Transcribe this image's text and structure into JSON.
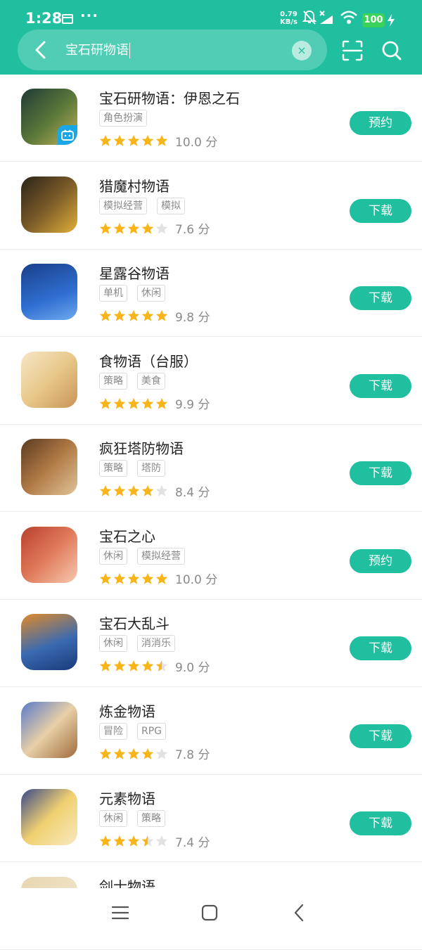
{
  "status_bar": {
    "time": "1:28",
    "more_dots": "···",
    "net_speed_value": "0.79",
    "net_speed_unit": "KB/s",
    "battery": "100"
  },
  "search": {
    "query": "宝石研物语",
    "clear_symbol": "×"
  },
  "colors": {
    "accent": "#1fbf9f",
    "star": "#f8b51a",
    "star_empty": "#e2e2e2"
  },
  "icons": [
    "back-icon",
    "clear-icon",
    "scan-icon",
    "search-icon",
    "menu-icon",
    "home-icon",
    "nav-back-icon"
  ],
  "results": [
    {
      "name": "宝石研物语：伊恩之石",
      "tags": [
        "角色扮演"
      ],
      "rating": 5,
      "score": "10.0 分",
      "action": "预约"
    },
    {
      "name": "猎魔村物语",
      "tags": [
        "模拟经营",
        "模拟"
      ],
      "rating": 4,
      "score": "7.6 分",
      "action": "下载"
    },
    {
      "name": "星露谷物语",
      "tags": [
        "单机",
        "休闲"
      ],
      "rating": 5,
      "score": "9.8 分",
      "action": "下载"
    },
    {
      "name": "食物语（台服）",
      "tags": [
        "策略",
        "美食"
      ],
      "rating": 5,
      "score": "9.9 分",
      "action": "下载"
    },
    {
      "name": "疯狂塔防物语",
      "tags": [
        "策略",
        "塔防"
      ],
      "rating": 4,
      "score": "8.4 分",
      "action": "下载"
    },
    {
      "name": "宝石之心",
      "tags": [
        "休闲",
        "模拟经营"
      ],
      "rating": 5,
      "score": "10.0 分",
      "action": "预约"
    },
    {
      "name": "宝石大乱斗",
      "tags": [
        "休闲",
        "消消乐"
      ],
      "rating": 4.5,
      "score": "9.0 分",
      "action": "下载"
    },
    {
      "name": "炼金物语",
      "tags": [
        "冒险",
        "RPG"
      ],
      "rating": 4,
      "score": "7.8 分",
      "action": "下载"
    },
    {
      "name": "元素物语",
      "tags": [
        "休闲",
        "策略"
      ],
      "rating": 3.5,
      "score": "7.4 分",
      "action": "下载"
    },
    {
      "name": "剑士物语",
      "tags": [],
      "rating": null,
      "score": "",
      "action": ""
    }
  ]
}
